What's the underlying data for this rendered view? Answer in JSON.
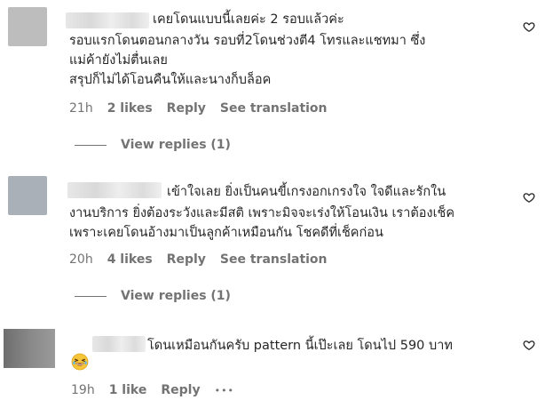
{
  "comments": [
    {
      "lines": [
        "เคยโดนแบบนี้เลยค่ะ 2 รอบแล้วค่ะ",
        "รอบแรกโดนตอนกลางวัน รอบที่2โดนช่วงตี4 โทรและแชทมา ซึ่ง",
        "แม่ค้ายังไม่ตื่นเลย",
        "สรุปก็ไม่ได้โอนคืนให้และนางก็บล็อค"
      ],
      "time": "21h",
      "likes": "2 likes",
      "reply": "Reply",
      "translate": "See translation",
      "view_replies": "View replies (1)"
    },
    {
      "lines": [
        "เข้าใจเลย ยิ่งเป็นคนขี้เกรงอกเกรงใจ ใจดีและรักใน",
        "งานบริการ ยิ่งต้องระวังและมีสติ เพราะมิจจะเร่งให้โอนเงิน เราต้องเช็ค",
        "เพราะเคยโดนอ้างมาเป็นลูกค้าเหมือนกัน โชคดีที่เช็คก่อน"
      ],
      "time": "20h",
      "likes": "4 likes",
      "reply": "Reply",
      "translate": "See translation",
      "view_replies": "View replies (1)"
    },
    {
      "lines": [
        "โดนเหมือนกันครับ pattern นี้เป๊ะเลย โดนไป 590 บาท"
      ],
      "emoji": "laughing-face-emoji",
      "time": "19h",
      "likes": "1 like",
      "reply": "Reply",
      "more": "•••"
    }
  ],
  "colors": {
    "text": "#262626",
    "secondary": "#737373",
    "background": "#ffffff"
  },
  "icons": {
    "like": "heart-outline-icon",
    "more": "more-options-icon"
  }
}
